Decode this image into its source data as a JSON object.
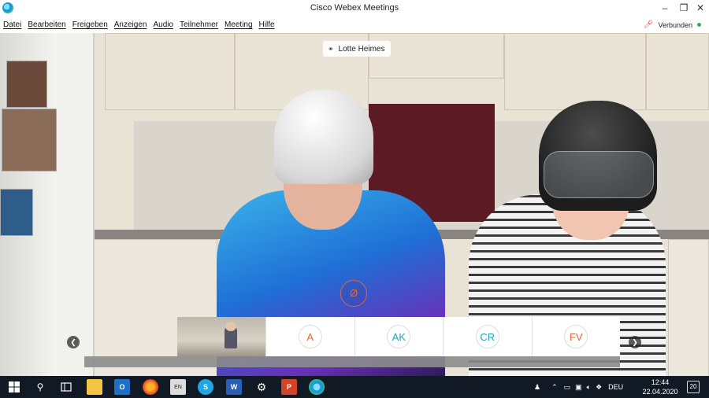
{
  "window": {
    "title": "Cisco Webex Meetings"
  },
  "menu": [
    "Datei",
    "Bearbeiten",
    "Freigeben",
    "Anzeigen",
    "Audio",
    "Teilnehmer",
    "Meeting",
    "Hilfe"
  ],
  "connection": {
    "status": "Verbunden",
    "color": "#2db34a"
  },
  "video": {
    "speaker_name": "Lotte Heimes"
  },
  "participants": [
    {
      "initials": "A",
      "color": "#e2653d"
    },
    {
      "initials": "AK",
      "color": "#1fa7b8"
    },
    {
      "initials": "CR",
      "color": "#1fa7b8"
    },
    {
      "initials": "FV",
      "color": "#e2653d"
    }
  ],
  "taskbar": {
    "apps": [
      "start",
      "search",
      "task-view",
      "file-explorer",
      "outlook",
      "firefox",
      "language-en",
      "skype",
      "word",
      "settings",
      "powerpoint",
      "webex"
    ],
    "language": "DEU",
    "time": "12:44",
    "date": "22.04.2020",
    "notifications": "20"
  },
  "colors": {
    "accent_orange": "#e2653d",
    "accent_teal": "#1fa7b8",
    "taskbar": "#111a24"
  }
}
